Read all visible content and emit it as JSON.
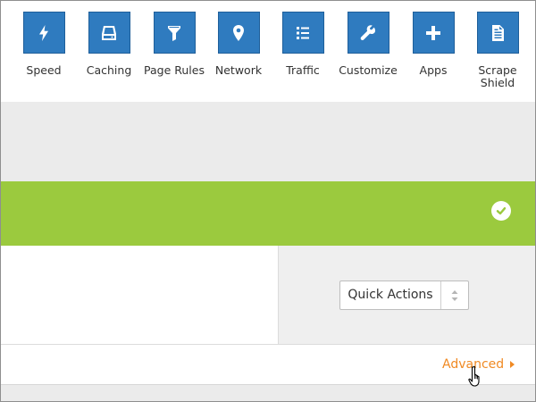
{
  "nav": {
    "items": [
      {
        "label": "Speed",
        "icon": "lightning-icon"
      },
      {
        "label": "Caching",
        "icon": "drive-icon"
      },
      {
        "label": "Page Rules",
        "icon": "filter-icon"
      },
      {
        "label": "Network",
        "icon": "location-pin-icon"
      },
      {
        "label": "Traffic",
        "icon": "list-icon"
      },
      {
        "label": "Customize",
        "icon": "wrench-icon"
      },
      {
        "label": "Apps",
        "icon": "plus-icon"
      },
      {
        "label": "Scrape Shield",
        "icon": "document-icon"
      }
    ]
  },
  "status": {
    "icon": "checkmark-icon",
    "color": "#9bca3e"
  },
  "quick_actions": {
    "label": "Quick Actions"
  },
  "advanced": {
    "label": "Advanced"
  },
  "colors": {
    "accent": "#2f7bbf",
    "link": "#f08a24",
    "success": "#9bca3e"
  }
}
